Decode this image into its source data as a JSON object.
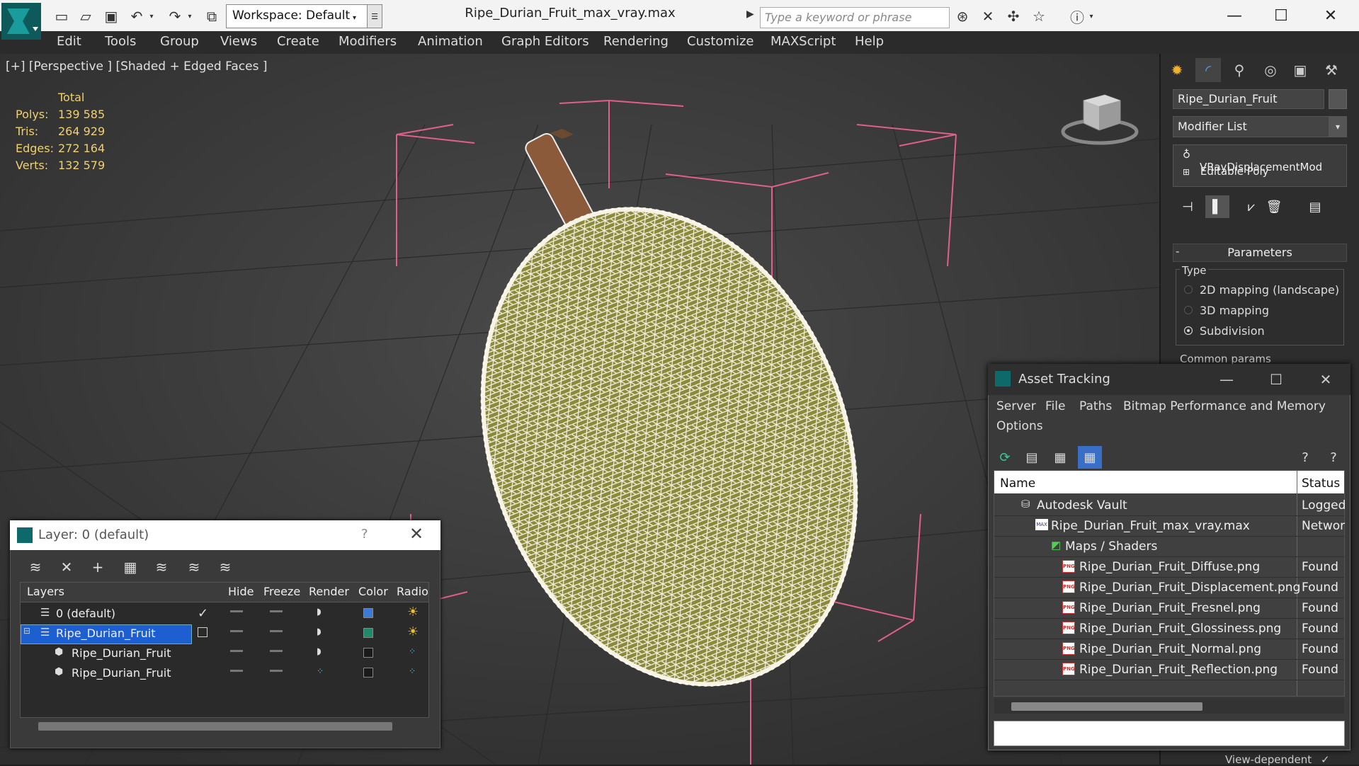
{
  "titlebar": {
    "workspace": "Workspace: Default",
    "title": "Ripe_Durian_Fruit_max_vray.max",
    "search_placeholder": "Type a keyword or phrase"
  },
  "menu": [
    "Edit",
    "Tools",
    "Group",
    "Views",
    "Create",
    "Modifiers",
    "Animation",
    "Graph Editors",
    "Rendering",
    "Customize",
    "MAXScript",
    "Help"
  ],
  "viewport": {
    "label": "[+] [Perspective ] [Shaded + Edged Faces ]",
    "stats_title": "Total",
    "stats": [
      {
        "label": "Polys:",
        "value": "139 585"
      },
      {
        "label": "Tris:",
        "value": "264 929"
      },
      {
        "label": "Edges:",
        "value": "272 164"
      },
      {
        "label": "Verts:",
        "value": "132 579"
      }
    ]
  },
  "command_panel": {
    "object_name": "Ripe_Durian_Fruit",
    "modifier_list": "Modifier List",
    "stack": [
      "VRayDisplacementMod",
      "Editable Poly"
    ],
    "parameters": "Parameters",
    "type_label": "Type",
    "type_options": [
      "2D mapping (landscape)",
      "3D mapping",
      "Subdivision"
    ],
    "selected_type": 2,
    "common_params": "Common params",
    "view_dependent": "View-dependent"
  },
  "layer_window": {
    "title": "Layer: 0 (default)",
    "help": "?",
    "columns": [
      "Layers",
      "Hide",
      "Freeze",
      "Render",
      "Color",
      "Radiosi"
    ],
    "rows": [
      {
        "name": "0 (default)",
        "color": "#3a7bd5"
      },
      {
        "name": "Ripe_Durian_Fruit",
        "color": "#1f8a6a"
      },
      {
        "name": "Ripe_Durian_Fruit",
        "color": "#1a1a1a"
      },
      {
        "name": "Ripe_Durian_Fruit",
        "color": "#1a1a1a"
      }
    ]
  },
  "asset_tracking": {
    "title": "Asset Tracking",
    "menu": [
      "Server",
      "File",
      "Paths",
      "Bitmap Performance and Memory",
      "Options"
    ],
    "columns": [
      "Name",
      "Status"
    ],
    "rows": [
      {
        "name": "Autodesk Vault",
        "status": "Logged"
      },
      {
        "name": "Ripe_Durian_Fruit_max_vray.max",
        "status": "Networ"
      },
      {
        "name": "Maps / Shaders",
        "status": ""
      },
      {
        "name": "Ripe_Durian_Fruit_Diffuse.png",
        "status": "Found"
      },
      {
        "name": "Ripe_Durian_Fruit_Displacement.png",
        "status": "Found"
      },
      {
        "name": "Ripe_Durian_Fruit_Fresnel.png",
        "status": "Found"
      },
      {
        "name": "Ripe_Durian_Fruit_Glossiness.png",
        "status": "Found"
      },
      {
        "name": "Ripe_Durian_Fruit_Normal.png",
        "status": "Found"
      },
      {
        "name": "Ripe_Durian_Fruit_Reflection.png",
        "status": "Found"
      }
    ]
  },
  "icons": {
    "png_badge": "PNG"
  }
}
